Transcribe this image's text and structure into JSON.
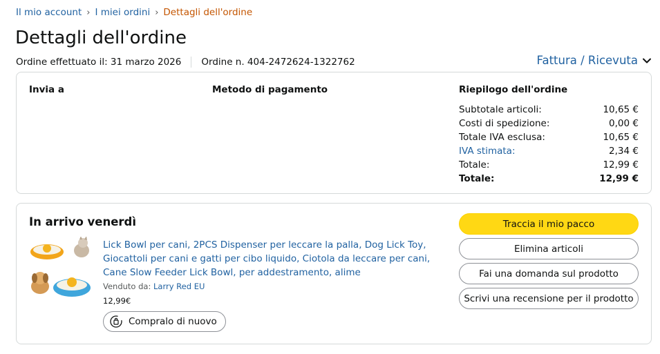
{
  "breadcrumb": {
    "items": [
      "Il mio account",
      "I miei ordini"
    ],
    "separator": "›",
    "current": "Dettagli dell'ordine"
  },
  "page": {
    "title": "Dettagli dell'ordine",
    "order_date": "Ordine effettuato il: 31 marzo 2026",
    "order_number": "Ordine n. 404-2472624-1322762",
    "invoice_link": "Fattura / Ricevuta"
  },
  "summary": {
    "ship_to_label": "Invia a",
    "payment_label": "Metodo di pagamento",
    "order_summary_label": "Riepilogo dell'ordine",
    "lines": [
      {
        "label": "Subtotale articoli:",
        "value": "10,65 €"
      },
      {
        "label": "Costi di spedizione:",
        "value": "0,00 €"
      },
      {
        "label": "Totale IVA esclusa:",
        "value": "10,65 €"
      },
      {
        "label": "IVA stimata:",
        "value": "2,34 €"
      },
      {
        "label": "Totale:",
        "value": "12,99 €"
      },
      {
        "label": "Totale:",
        "value": "12,99 €"
      }
    ]
  },
  "shipment": {
    "arrival": "In arrivo venerdì",
    "product_title": "Lick Bowl per cani, 2PCS Dispenser per leccare la palla, Dog Lick Toy, Giocattoli per cani e gatti per cibo liquido, Ciotola da leccare per cani, Cane Slow Feeder Lick Bowl, per addestramento, alime",
    "sold_by_label": "Venduto da:",
    "seller": "Larry Red EU",
    "price": "12,99€",
    "buy_again": "Compralo di nuovo",
    "buttons": {
      "track": "Traccia il mio pacco",
      "delete": "Elimina articoli",
      "question": "Fai una domanda sul prodotto",
      "review": "Scrivi una recensione per il prodotto"
    }
  },
  "colors": {
    "link": "#2162a1",
    "current_breadcrumb": "#c45500",
    "primary_button": "#ffd814",
    "border": "#d5d9d9"
  },
  "icons": {
    "invoice_chevron": "chevron-down-icon",
    "buy_again": "rebuy-icon"
  }
}
